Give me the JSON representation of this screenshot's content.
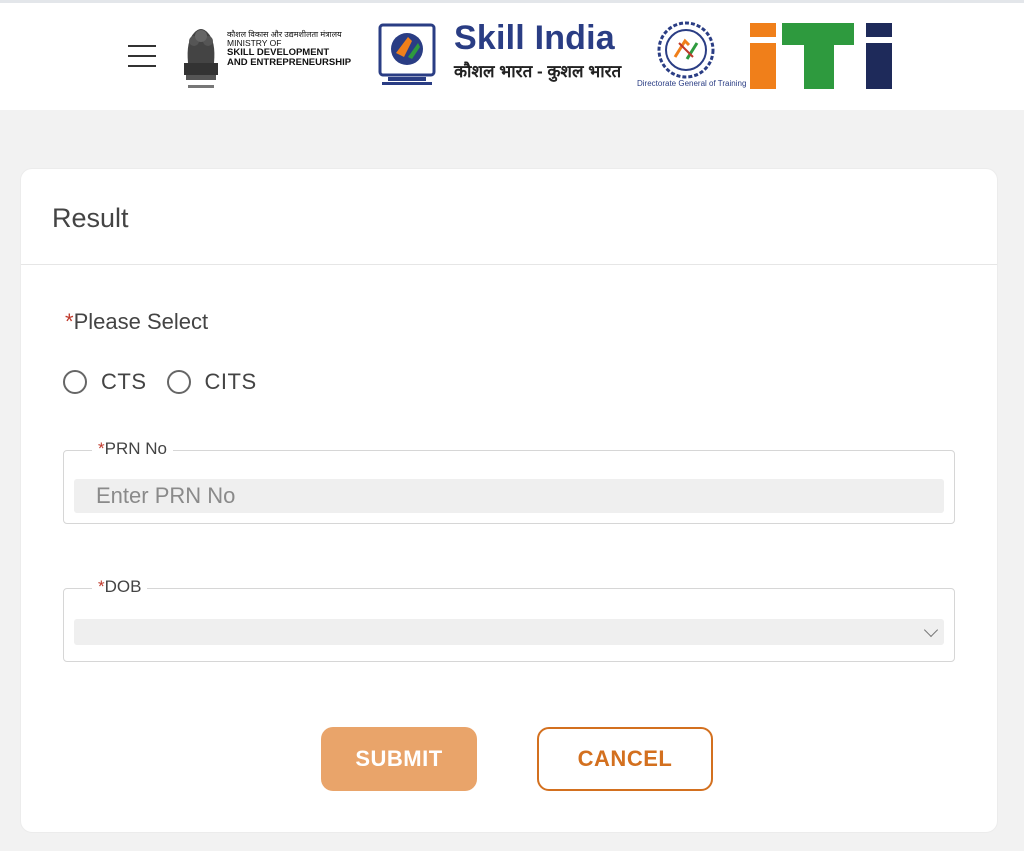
{
  "header": {
    "ministry": {
      "hindi": "कौशल विकास और उद्यमशीलता मंत्रालय",
      "line1": "MINISTRY OF",
      "line2": "SKILL DEVELOPMENT",
      "line3": "AND ENTREPRENEURSHIP"
    },
    "skill_india": {
      "title": "Skill India",
      "subtitle": "कौशल भारत - कुशल भारत"
    },
    "dgt_caption": "Directorate General of Training",
    "brand_colors": {
      "navy": "#2a3d84",
      "orange": "#f07f1a",
      "green": "#2e9a3e"
    }
  },
  "card": {
    "title": "Result",
    "please_select": {
      "required_mark": "*",
      "label": "Please Select"
    },
    "radios": [
      {
        "label": "CTS"
      },
      {
        "label": "CITS"
      }
    ],
    "prn": {
      "required_mark": "*",
      "label": "PRN No",
      "placeholder": "Enter PRN No",
      "value": ""
    },
    "dob": {
      "required_mark": "*",
      "label": "DOB",
      "value": ""
    },
    "buttons": {
      "submit": "SUBMIT",
      "cancel": "CANCEL"
    }
  }
}
